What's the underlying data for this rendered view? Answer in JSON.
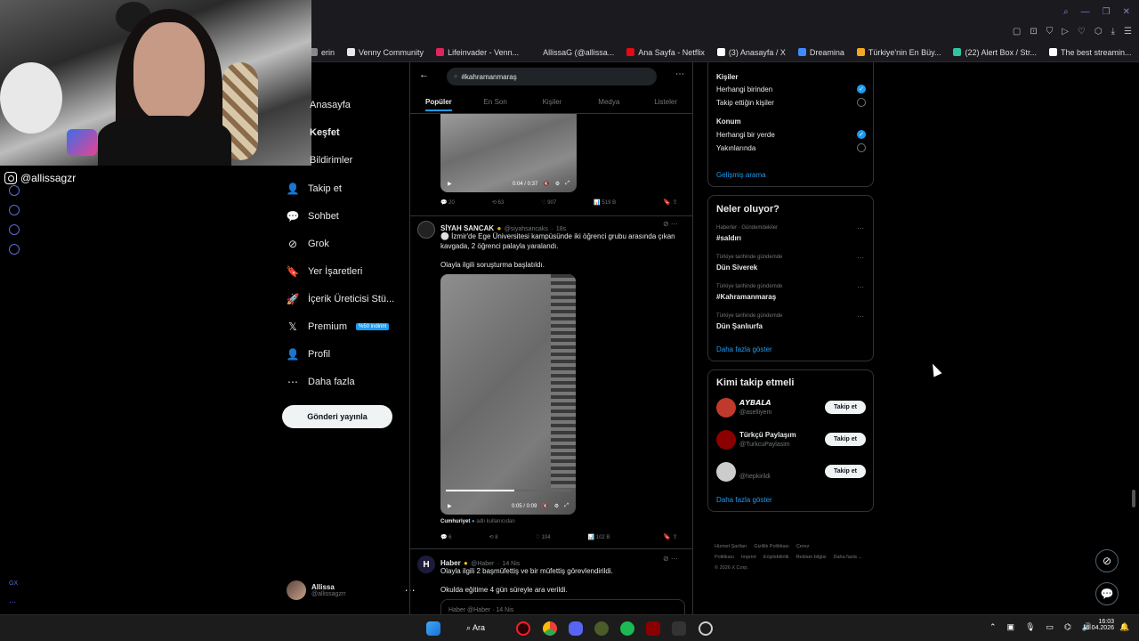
{
  "browser": {
    "bookmarks": [
      {
        "label": "erin",
        "color": "#888888"
      },
      {
        "label": "Venny Community",
        "color": "#e7e9ea"
      },
      {
        "label": "Lifeinvader - Venn...",
        "color": "#e0245e"
      },
      {
        "label": "AllissaG (@allissa...",
        "color": "#1b1b1f"
      },
      {
        "label": "Ana Sayfa - Netflix",
        "color": "#e50914"
      },
      {
        "label": "(3) Anasayfa / X",
        "color": "#ffffff"
      },
      {
        "label": "Dreamina",
        "color": "#3d8bfd"
      },
      {
        "label": "Türkiye'nin En Büy...",
        "color": "#f5a623"
      },
      {
        "label": "(22) Alert Box / Str...",
        "color": "#31c3a2"
      },
      {
        "label": "The best streamin...",
        "color": "#ffffff"
      }
    ]
  },
  "stream": {
    "handle": "@allissagzr"
  },
  "nav": {
    "items": [
      {
        "label": "Anasayfa",
        "icon": "home-icon"
      },
      {
        "label": "Keşfet",
        "icon": "search-icon"
      },
      {
        "label": "Bildirimler",
        "icon": "bell-icon"
      },
      {
        "label": "Takip et",
        "icon": "follow-icon",
        "glyph": "👤"
      },
      {
        "label": "Sohbet",
        "icon": "chat-icon",
        "glyph": "💬"
      },
      {
        "label": "Grok",
        "icon": "grok-icon",
        "glyph": "⊘"
      },
      {
        "label": "Yer İşaretleri",
        "icon": "bookmark-icon",
        "glyph": "🔖"
      },
      {
        "label": "İçerik Üreticisi Stü...",
        "icon": "rocket-icon",
        "glyph": "🚀"
      },
      {
        "label": "Premium",
        "icon": "x-logo-icon",
        "glyph": "𝕏"
      },
      {
        "label": "Profil",
        "icon": "profile-icon",
        "glyph": "👤"
      },
      {
        "label": "Daha fazla",
        "icon": "more-icon",
        "glyph": "⋯"
      }
    ],
    "premium_badge": "%50 indirim",
    "post_button": "Gönderi yayınla",
    "account": {
      "name": "Allissa",
      "handle": "@allissagzrr"
    }
  },
  "search": {
    "query": "#kahramanmaraş",
    "tabs": [
      "Popüler",
      "En Son",
      "Kişiler",
      "Medya",
      "Listeler"
    ]
  },
  "tweets": [
    {
      "video_time": "0:04 / 0:37",
      "actions": {
        "replies": "20",
        "retweets": "63",
        "likes": "907",
        "views": "519 B"
      }
    },
    {
      "name": "SİYAH SANCAK",
      "handle": "@siyahsancaks",
      "time": "18s",
      "text": "⚪ İzmir'de Ege Üniversitesi kampüsünde iki öğrenci grubu arasında çıkan kavgada, 2 öğrenci palayla yaralandı.",
      "text2": "Olayla ilgili soruşturma başlatıldı.",
      "video_time": "0:05 / 0:09",
      "source_name": "Cumhuriyet",
      "source_note": "adlı kullanıcıdan",
      "actions": {
        "replies": "6",
        "retweets": "8",
        "likes": "104",
        "views": "102 B"
      }
    },
    {
      "name": "Haber",
      "handle": "@Haber",
      "time": "14 Nis",
      "text": "Olayla ilgili 2 başmüfettiş ve bir müfettiş görevlendirildi.",
      "text2": "Okulda eğitime 4 gün süreyle ara verildi.",
      "quote": "Haber @Haber · 14 Nis"
    }
  ],
  "filters": {
    "people_title": "Kişiler",
    "people_options": [
      {
        "label": "Herhangi birinden",
        "checked": true
      },
      {
        "label": "Takip ettiğin kişiler",
        "checked": false
      }
    ],
    "location_title": "Konum",
    "location_options": [
      {
        "label": "Herhangi bir yerde",
        "checked": true
      },
      {
        "label": "Yakınlarında",
        "checked": false
      }
    ],
    "advanced_link": "Gelişmiş arama"
  },
  "trends": {
    "title": "Neler oluyor?",
    "items": [
      {
        "context": "Haberler · Gündemdekiler",
        "name": "#saldırı"
      },
      {
        "context": "Türkiye tarihinde gündemde",
        "name": "Dün Siverek"
      },
      {
        "context": "Türkiye tarihinde gündemde",
        "name": "#Kahramanmaraş"
      },
      {
        "context": "Türkiye tarihinde gündemde",
        "name": "Dün Şanlıurfa"
      }
    ],
    "more": "Daha fazla göster"
  },
  "who_to_follow": {
    "title": "Kimi takip etmeli",
    "items": [
      {
        "name": "𝘼𝙔𝘽𝘼𝙇𝘼",
        "handle": "@aselliyem",
        "button": "Takip et",
        "color": "#c0392b"
      },
      {
        "name": "Türkçü Paylaşım",
        "handle": "@TurkcuPaylasim",
        "button": "Takip et",
        "color": "#8b0000"
      },
      {
        "name": "",
        "handle": "@hepkirildi",
        "button": "Takip et",
        "color": "#cccccc"
      }
    ],
    "more": "Daha fazla göster"
  },
  "footer": {
    "links": [
      "Hizmet Şartları",
      "Gizlilik Politikası",
      "Çerez Politikası",
      "Imprint",
      "Erişilebilirlik",
      "Reklam bilgisi",
      "Daha fazla ..."
    ],
    "copyright": "© 2026 X Corp."
  },
  "taskbar": {
    "search": "Ara",
    "time": "16:03",
    "date": "15.04.2026"
  }
}
